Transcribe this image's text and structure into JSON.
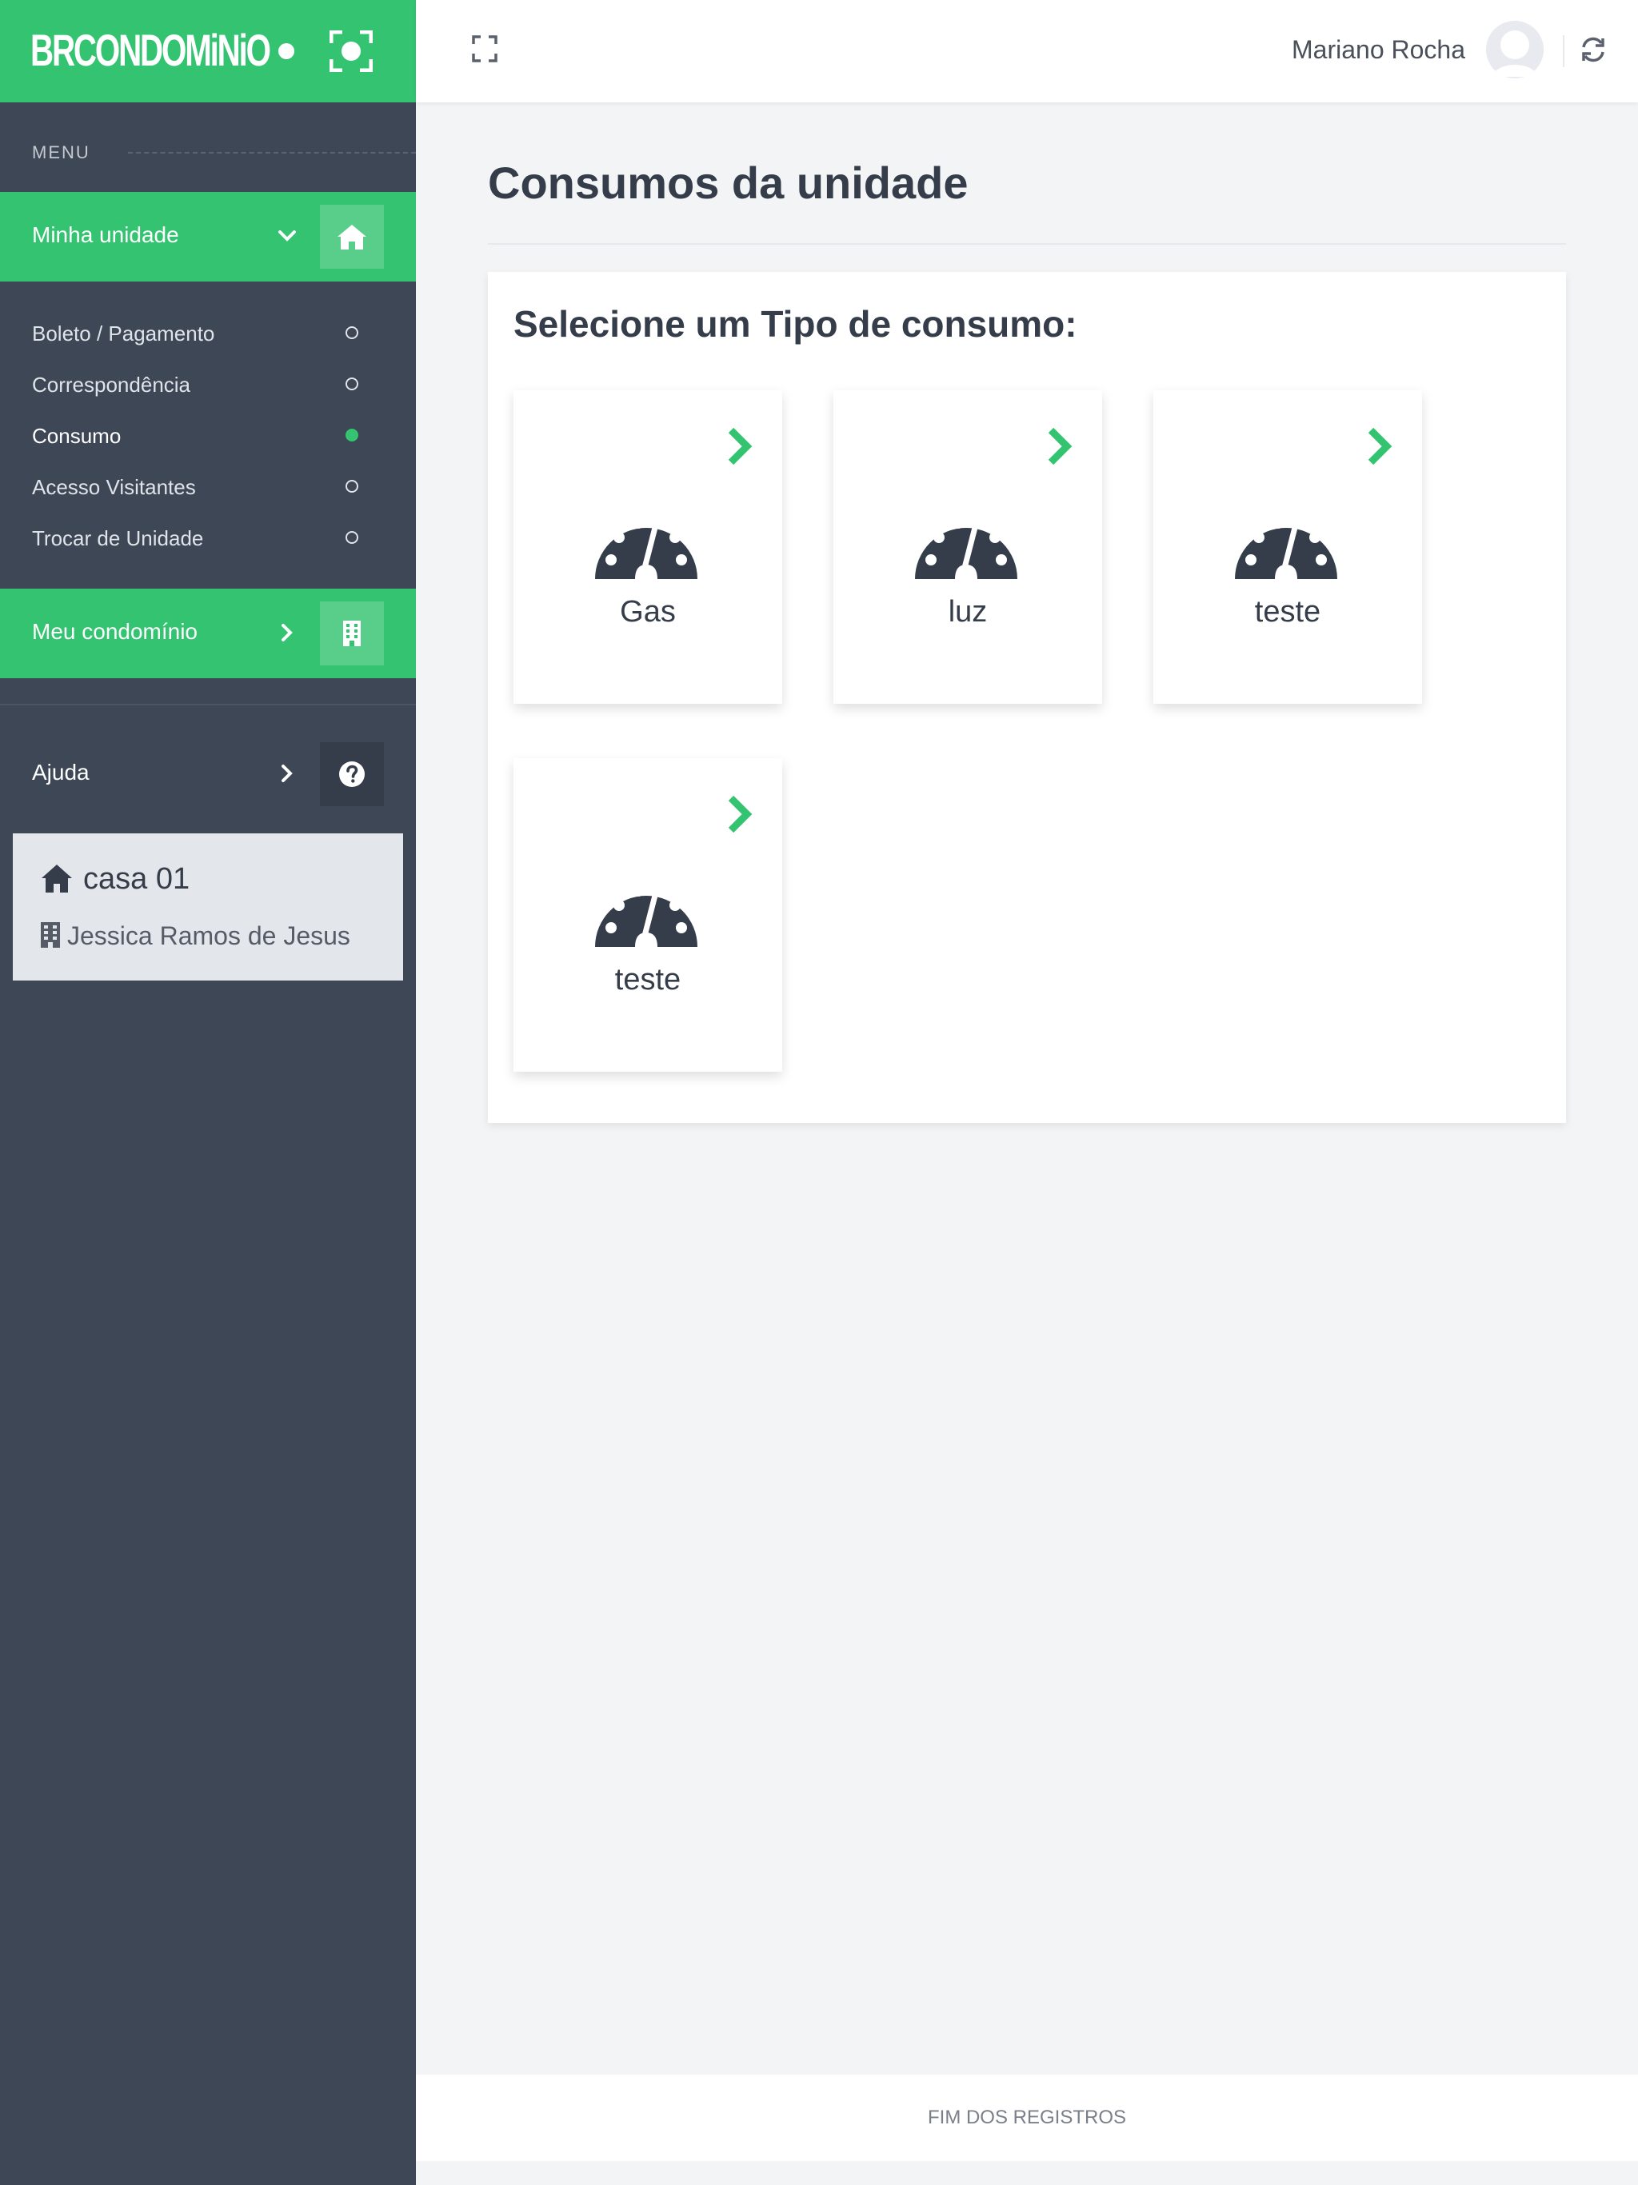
{
  "brand": {
    "logo_text": "BRCONDOMiNiO"
  },
  "sidebar": {
    "menu_label": "MENU",
    "minha_unidade": {
      "label": "Minha unidade"
    },
    "subitems": [
      {
        "label": "Boleto / Pagamento",
        "active": false
      },
      {
        "label": "Correspondência",
        "active": false
      },
      {
        "label": "Consumo",
        "active": true
      },
      {
        "label": "Acesso Visitantes",
        "active": false
      },
      {
        "label": "Trocar de Unidade",
        "active": false
      }
    ],
    "meu_condominio": {
      "label": "Meu condomínio"
    },
    "ajuda": {
      "label": "Ajuda"
    },
    "unit": {
      "title": "casa 01",
      "owner": "Jessica Ramos de Jesus"
    }
  },
  "header": {
    "user_name": "Mariano Rocha"
  },
  "page": {
    "title": "Consumos da unidade",
    "panel_title": "Selecione um Tipo de consumo:",
    "consumption_types": [
      {
        "name": "Gas"
      },
      {
        "name": "luz"
      },
      {
        "name": "teste"
      },
      {
        "name": "teste"
      }
    ]
  },
  "footer": {
    "text": "FIM DOS REGISTROS"
  },
  "colors": {
    "accent": "#34c471",
    "sidebar": "#3e4756",
    "text": "#363d4a"
  }
}
